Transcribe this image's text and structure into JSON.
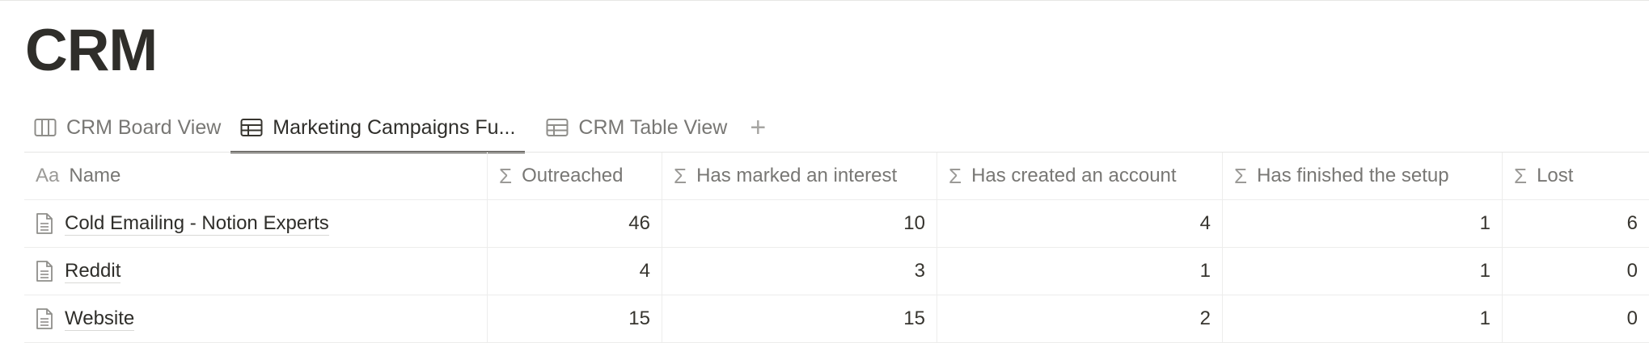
{
  "page": {
    "title": "CRM"
  },
  "tabs": [
    {
      "label": "CRM Board View",
      "icon": "board-icon",
      "active": false
    },
    {
      "label": "Marketing Campaigns Fu...",
      "icon": "table-icon",
      "active": true
    },
    {
      "label": "CRM Table View",
      "icon": "table-icon",
      "active": false
    }
  ],
  "add_view_label": "+",
  "table": {
    "columns": [
      {
        "label": "Name",
        "icon": "text-property-icon",
        "icon_text": "Aa"
      },
      {
        "label": "Outreached",
        "icon": "sigma-icon",
        "icon_text": "Σ"
      },
      {
        "label": "Has marked an interest",
        "icon": "sigma-icon",
        "icon_text": "Σ"
      },
      {
        "label": "Has created an account",
        "icon": "sigma-icon",
        "icon_text": "Σ"
      },
      {
        "label": "Has finished the setup",
        "icon": "sigma-icon",
        "icon_text": "Σ"
      },
      {
        "label": "Lost",
        "icon": "sigma-icon",
        "icon_text": "Σ"
      }
    ],
    "rows": [
      {
        "name": "Cold Emailing - Notion Experts",
        "outreached": "46",
        "interest": "10",
        "account": "4",
        "setup": "1",
        "lost": "6"
      },
      {
        "name": "Reddit",
        "outreached": "4",
        "interest": "3",
        "account": "1",
        "setup": "1",
        "lost": "0"
      },
      {
        "name": "Website",
        "outreached": "15",
        "interest": "15",
        "account": "2",
        "setup": "1",
        "lost": "0"
      }
    ]
  },
  "colors": {
    "text": "#37352f",
    "muted": "#787774",
    "border": "#ededec",
    "active_underline": "#37352f"
  }
}
